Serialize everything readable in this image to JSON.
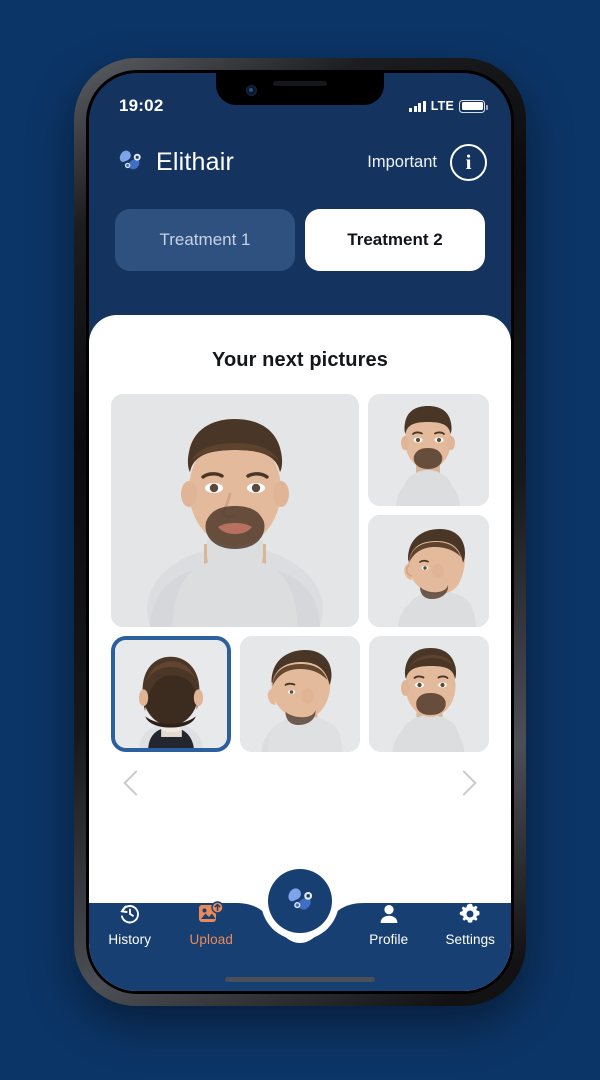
{
  "theme": {
    "page_background": "#0c3567",
    "app_header_background": "#14345f",
    "card_background": "#ffffff",
    "accent_blue": "#2b5f9e",
    "upload_orange": "#e98a5a",
    "inactive_tab": "#2e5180",
    "nav_background": "#183f72",
    "chevron_grey": "#c7c9cc"
  },
  "status_bar": {
    "time": "19:02",
    "network_label": "LTE",
    "signal_icon": "signal-bars-icon",
    "battery_icon": "battery-full-icon",
    "battery_level": "100"
  },
  "header": {
    "logo_icon": "elithair-logo-icon",
    "brand": "Elithair",
    "important_label": "Important",
    "info_icon": "info-circle-icon",
    "info_glyph": "i"
  },
  "tabs": [
    {
      "label": "Treatment 1",
      "active": false
    },
    {
      "label": "Treatment 2",
      "active": true
    }
  ],
  "main": {
    "title": "Your next pictures",
    "photos": [
      {
        "name": "photo-front-large",
        "alt": "Man front view portrait, grey turtleneck",
        "selected": false,
        "size": "large"
      },
      {
        "name": "photo-front-small",
        "alt": "Man front view portrait thumbnail",
        "selected": false,
        "size": "small"
      },
      {
        "name": "photo-side-profile",
        "alt": "Man left side profile thumbnail",
        "selected": false,
        "size": "small"
      },
      {
        "name": "photo-back-head",
        "alt": "Back of head view thumbnail",
        "selected": true,
        "size": "tile"
      },
      {
        "name": "photo-right-profile",
        "alt": "Man right side profile thumbnail",
        "selected": false,
        "size": "tile"
      },
      {
        "name": "photo-three-quarter",
        "alt": "Man three quarter view thumbnail",
        "selected": false,
        "size": "tile"
      }
    ],
    "carousel": {
      "prev_icon": "chevron-left-icon",
      "next_icon": "chevron-right-icon"
    }
  },
  "bottom_nav": {
    "fab_icon": "elithair-logo-icon",
    "items": [
      {
        "label": "History",
        "icon": "history-clock-icon",
        "active": false
      },
      {
        "label": "Upload",
        "icon": "image-upload-icon",
        "active": true
      },
      {
        "label": "Profile",
        "icon": "person-icon",
        "active": false
      },
      {
        "label": "Settings",
        "icon": "gear-icon",
        "active": false
      }
    ]
  },
  "home_indicator": "home-indicator-bar"
}
